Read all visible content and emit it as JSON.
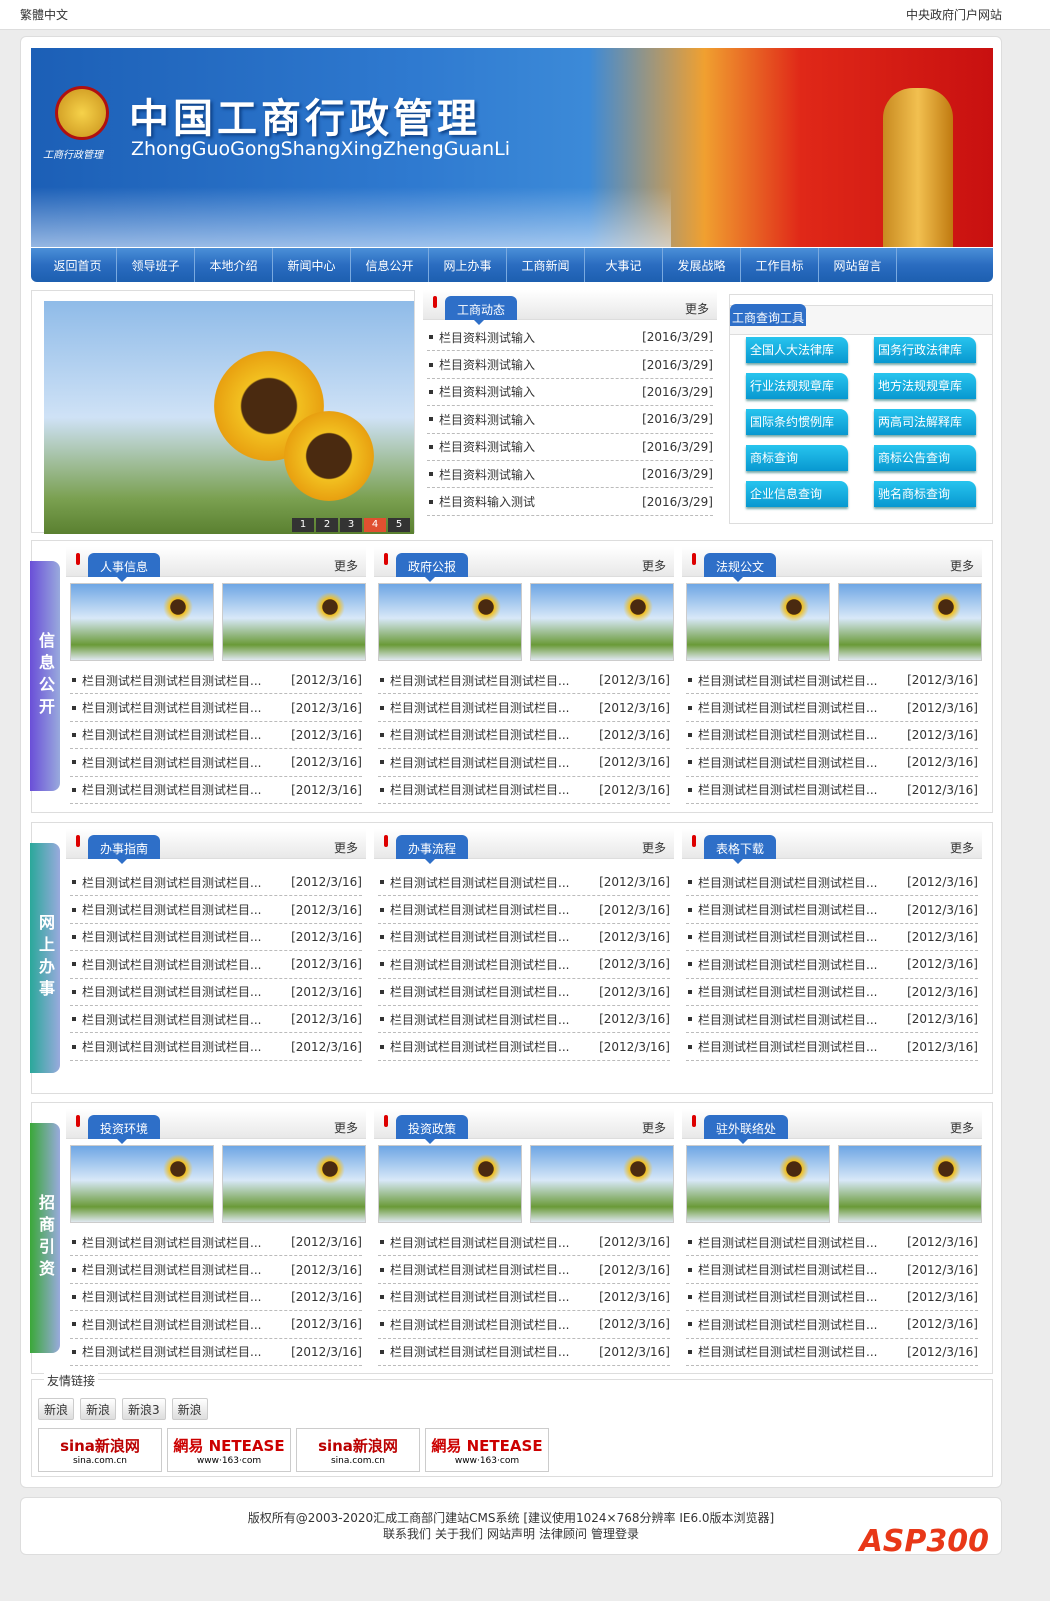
{
  "topbar": {
    "left": "繁體中文",
    "right": "中央政府门户网站"
  },
  "banner": {
    "title": "中国工商行政管理",
    "subtitle": "ZhongGuoGongShangXingZhengGuanLi",
    "emblem_text": "工商行政管理"
  },
  "nav": [
    "返回首页",
    "领导班子",
    "本地介绍",
    "新闻中心",
    "信息公开",
    "网上办事",
    "工商新闻",
    "大事记",
    "发展战略",
    "工作目标",
    "网站留言"
  ],
  "slider": {
    "pages": [
      "1",
      "2",
      "3",
      "4",
      "5"
    ],
    "active": 4
  },
  "news": {
    "title": "工商动态",
    "more": "更多",
    "items": [
      {
        "t": "栏目资料测试输入",
        "d": "[2016/3/29]"
      },
      {
        "t": "栏目资料测试输入",
        "d": "[2016/3/29]"
      },
      {
        "t": "栏目资料测试输入",
        "d": "[2016/3/29]"
      },
      {
        "t": "栏目资料测试输入",
        "d": "[2016/3/29]"
      },
      {
        "t": "栏目资料测试输入",
        "d": "[2016/3/29]"
      },
      {
        "t": "栏目资料测试输入",
        "d": "[2016/3/29]"
      },
      {
        "t": "栏目资料输入测试",
        "d": "[2016/3/29]"
      }
    ]
  },
  "tools": {
    "title": "工商查询工具",
    "items": [
      "全国人大法律库",
      "国务行政法律库",
      "行业法规规章库",
      "地方法规规章库",
      "国际条约惯例库",
      "两高司法解释库",
      "商标查询",
      "商标公告查询",
      "企业信息查询",
      "驰名商标查询"
    ]
  },
  "sections": [
    {
      "label": "信息公开",
      "color": "#6a4fd8",
      "thumbs": true,
      "cols": [
        {
          "title": "人事信息"
        },
        {
          "title": "政府公报"
        },
        {
          "title": "法规公文"
        }
      ],
      "rows": 5
    },
    {
      "label": "网上办事",
      "color": "#2aa89a",
      "thumbs": false,
      "cols": [
        {
          "title": "办事指南"
        },
        {
          "title": "办事流程"
        },
        {
          "title": "表格下载"
        }
      ],
      "rows": 7
    },
    {
      "label": "招商引资",
      "color": "#3aa838",
      "thumbs": true,
      "cols": [
        {
          "title": "投资环境"
        },
        {
          "title": "投资政策"
        },
        {
          "title": "驻外联络处"
        }
      ],
      "rows": 5
    }
  ],
  "item_text": "栏目测试栏目测试栏目测试栏目...",
  "item_date": "[2012/3/16]",
  "more": "更多",
  "links": {
    "legend": "友情链接",
    "buttons": [
      "新浪",
      "新浪",
      "新浪3",
      "新浪"
    ],
    "logos": [
      {
        "name": "sina新浪网",
        "url": "sina.com.cn"
      },
      {
        "name": "網易 NETEASE",
        "url": "www·163·com"
      },
      {
        "name": "sina新浪网",
        "url": "sina.com.cn"
      },
      {
        "name": "網易 NETEASE",
        "url": "www·163·com"
      }
    ]
  },
  "footer": {
    "line1": "版权所有@2003-2020汇成工商部门建站CMS系统 [建议使用1024×768分辨率 IE6.0版本浏览器]",
    "line2": [
      "联系我们",
      "关于我们",
      "网站声明",
      "法律顾问",
      "管理登录"
    ],
    "watermark": "ASP300"
  }
}
